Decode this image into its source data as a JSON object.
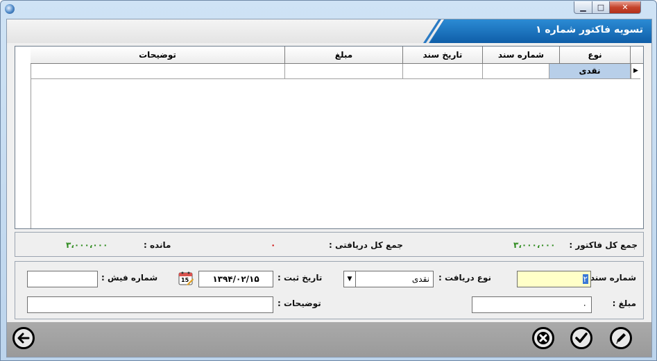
{
  "window": {
    "minimize_glyph": "▁",
    "maximize_glyph": "□",
    "close_glyph": "✕",
    "title": "تسویه فاکتور شماره ۱"
  },
  "grid": {
    "columns": [
      "نوع",
      "شماره سند",
      "تاریخ سند",
      "مبلغ",
      "توضیحات"
    ],
    "rows": [
      {
        "type": "نقدی",
        "doc_number": "",
        "doc_date": "",
        "amount": "",
        "description": ""
      }
    ],
    "row_indicator": "▶"
  },
  "summary": {
    "invoice_total_label": "جمع کل فاکتور :",
    "invoice_total_value": "۳،۰۰۰،۰۰۰",
    "received_total_label": "جمع کل دریافتی :",
    "received_total_value": "۰",
    "remaining_label": "مانده :",
    "remaining_value": "۳،۰۰۰،۰۰۰"
  },
  "form": {
    "doc_number_label": "شماره سند :",
    "doc_number_value": "۲",
    "receive_type_label": "نوع دریافت :",
    "receive_type_value": "نقدی",
    "reg_date_label": "تاریخ ثبت :",
    "reg_date_value": "۱۳۹۴/۰۲/۱۵",
    "calendar_day": "15",
    "receipt_number_label": "شماره فیش :",
    "receipt_number_value": "",
    "amount_label": "مبلغ :",
    "amount_value": "۰",
    "description_label": "توضیحات :",
    "description_value": ""
  },
  "colors": {
    "summary_value": "#2e8b1e",
    "received_value": "#cc0000",
    "selected_cell": "#b8cfe9",
    "focused_field": "#ffffc8",
    "header_blue": "#1a6fbd"
  },
  "icons": [
    "app-icon",
    "minimize-icon",
    "maximize-icon",
    "close-icon",
    "calendar-icon",
    "dropdown-arrow-icon",
    "back-arrow-icon",
    "cancel-icon",
    "confirm-check-icon",
    "edit-pencil-icon"
  ]
}
